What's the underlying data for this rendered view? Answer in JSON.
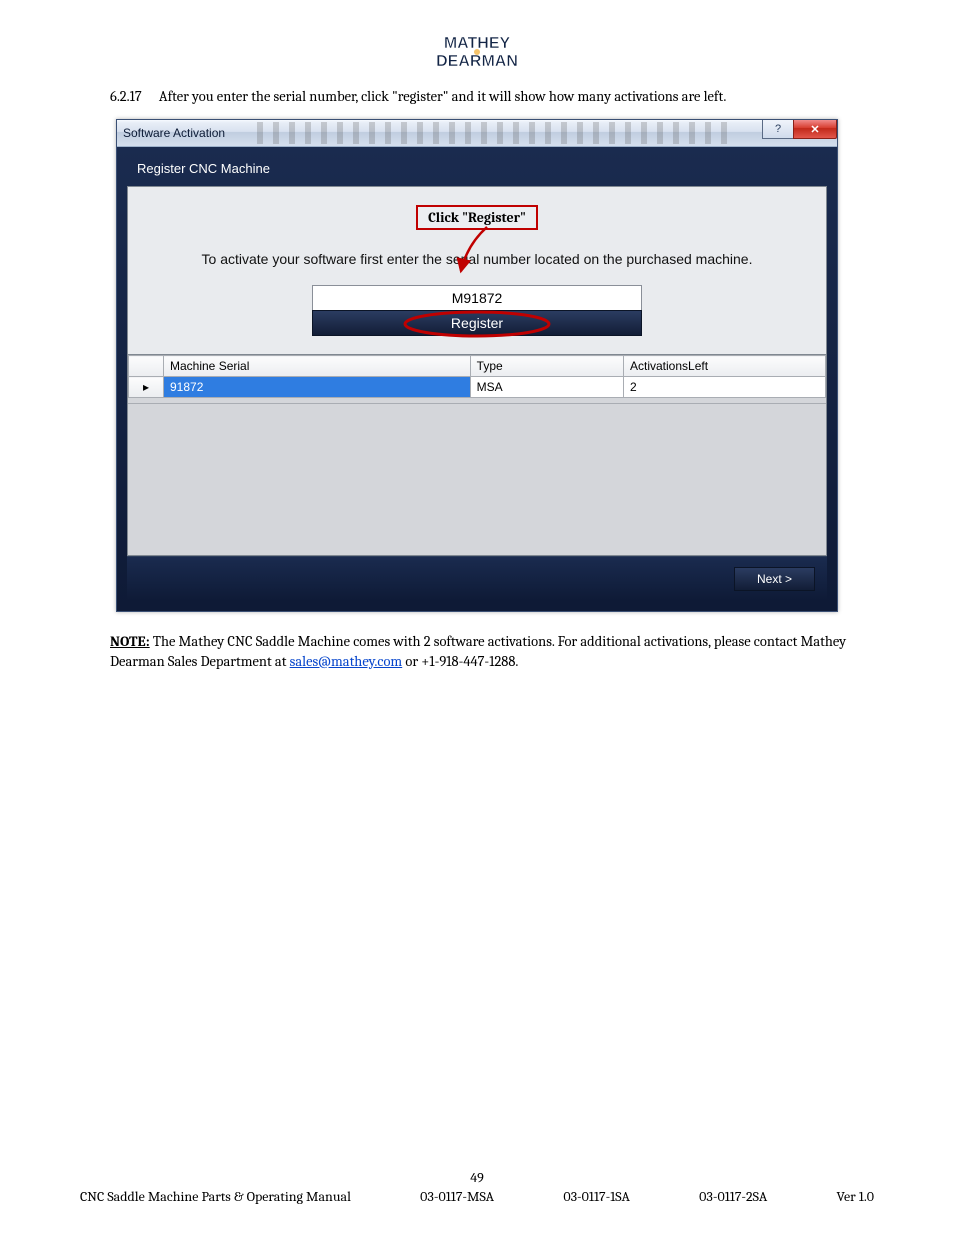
{
  "logo": {
    "line1": "MATHEY",
    "line2": "DEARMAN"
  },
  "instruction": {
    "number": "6.2.17",
    "text": "After you enter the serial number, click \"register\" and it will show how many activations are left."
  },
  "window": {
    "title": "Software Activation",
    "help_tooltip": "?",
    "close_tooltip": "✕",
    "subheader": "Register CNC Machine",
    "callout": "Click \"Register\"",
    "activate_msg": "To activate your software first enter the serial number located on the purchased machine.",
    "serial_value": "M91872",
    "register_label": "Register",
    "columns": {
      "rowhead": "",
      "serial": "Machine Serial",
      "type": "Type",
      "left": "ActivationsLeft"
    },
    "rows": [
      {
        "indicator": "▸",
        "serial": "91872",
        "type": "MSA",
        "left": "2"
      }
    ],
    "next_label": "Next  >"
  },
  "note": {
    "label": "NOTE:",
    "text1": " The Mathey CNC Saddle Machine comes with 2 software activations.  For additional activations, please contact Mathey Dearman Sales Department at ",
    "email": "sales@mathey.com",
    "text2": " or +1-918-447-1288."
  },
  "footer": {
    "page": "49",
    "title": "CNC Saddle Machine Parts & Operating Manual",
    "codes": [
      "03-0117-MSA",
      "03-0117-1SA",
      "03-0117-2SA"
    ],
    "version": "Ver 1.0"
  }
}
